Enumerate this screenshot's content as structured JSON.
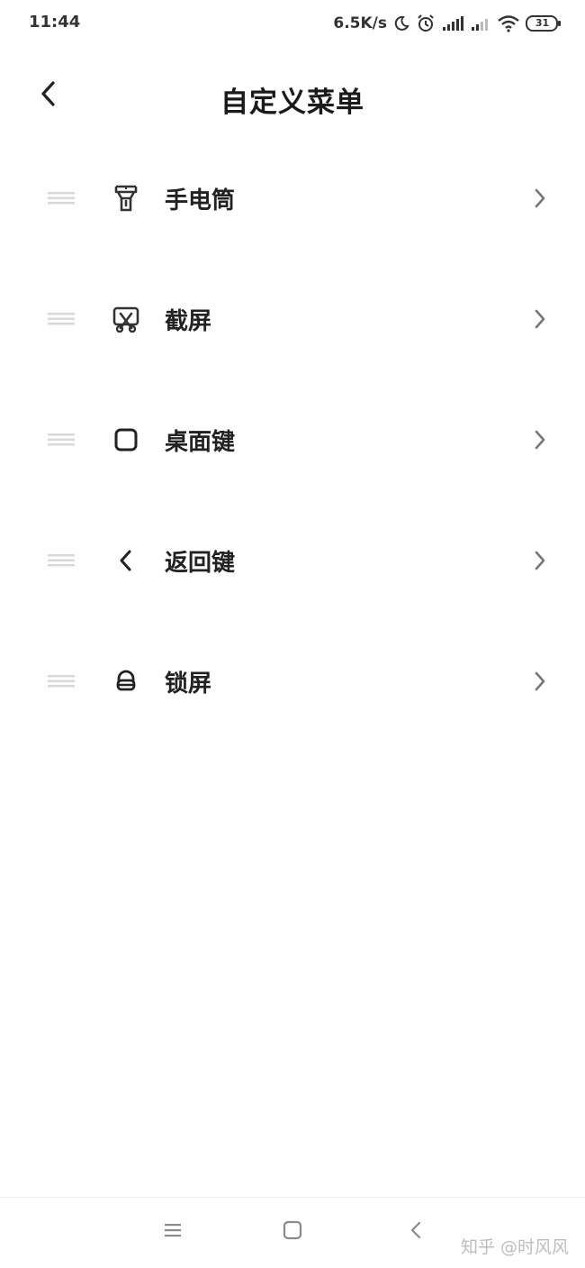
{
  "status_bar": {
    "time": "11:44",
    "net_speed": "6.5K/s",
    "battery": "31",
    "icons": [
      "moon-icon",
      "alarm-icon",
      "signal-icon",
      "signal-weak-icon",
      "wifi-icon",
      "battery-icon"
    ]
  },
  "header": {
    "title": "自定义菜单",
    "back_icon": "chevron-left-icon"
  },
  "menu": {
    "items": [
      {
        "label": "手电筒",
        "icon": "flashlight-icon"
      },
      {
        "label": "截屏",
        "icon": "screenshot-icon"
      },
      {
        "label": "桌面键",
        "icon": "home-key-icon"
      },
      {
        "label": "返回键",
        "icon": "back-key-icon"
      },
      {
        "label": "锁屏",
        "icon": "lock-icon"
      }
    ]
  },
  "nav_bar": {
    "icons": [
      "menu-icon",
      "home-icon",
      "back-icon"
    ],
    "watermark": "知乎 @时风风"
  },
  "colors": {
    "background": "#ffffff",
    "text": "#222222",
    "icon": "#333333",
    "drag_handle": "#d8d8d8",
    "chevron": "#777777",
    "muted": "#bdbdbd"
  }
}
